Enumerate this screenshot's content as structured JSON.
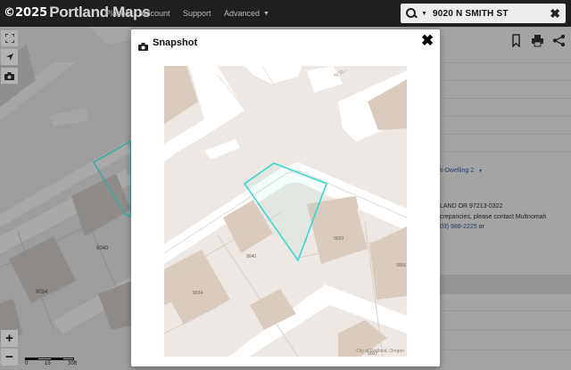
{
  "header": {
    "copyright": "©2025",
    "brand": "Portland Maps",
    "nav": [
      {
        "label": "Places"
      },
      {
        "label": "Account"
      },
      {
        "label": "Support"
      },
      {
        "label": "Advanced"
      }
    ],
    "search": {
      "value": "9020 N SMITH ST",
      "icon": "search-icon",
      "clear_icon": "close-icon"
    }
  },
  "map": {
    "zoom_in_label": "+",
    "zoom_out_label": "−",
    "scale": {
      "labels": [
        "0",
        "15",
        "30ft"
      ]
    },
    "labels": {
      "lot_9040": "9040",
      "lot_9034": "9034"
    }
  },
  "modal": {
    "title": "Snapshot",
    "icon": "camera-icon",
    "close_label": "✖",
    "map": {
      "street_label": "N St...",
      "lot_9040": "9040",
      "lot_9034": "9034",
      "lot_9020": "9020",
      "lot_9006": "9006",
      "lot_9007": "9007",
      "attribution": "City of Portland, Oregon"
    }
  },
  "panel": {
    "icons": [
      "bookmark-icon",
      "print-icon",
      "share-icon"
    ],
    "zoning_text": "ti-Dwelling 2",
    "address_text": "LAND OR 97213-0322",
    "discrepancy_text": "crepancies, please contact Multnomah",
    "phone_text": "03) 988-2225",
    "phone_suffix": " or"
  },
  "colors": {
    "topbar": "#1f1f1f",
    "parcel_highlight": "#3ad6cf",
    "building": "#d9cbbe",
    "street": "#ffffff",
    "ground": "#ede8e4",
    "link": "#1e3b68"
  }
}
